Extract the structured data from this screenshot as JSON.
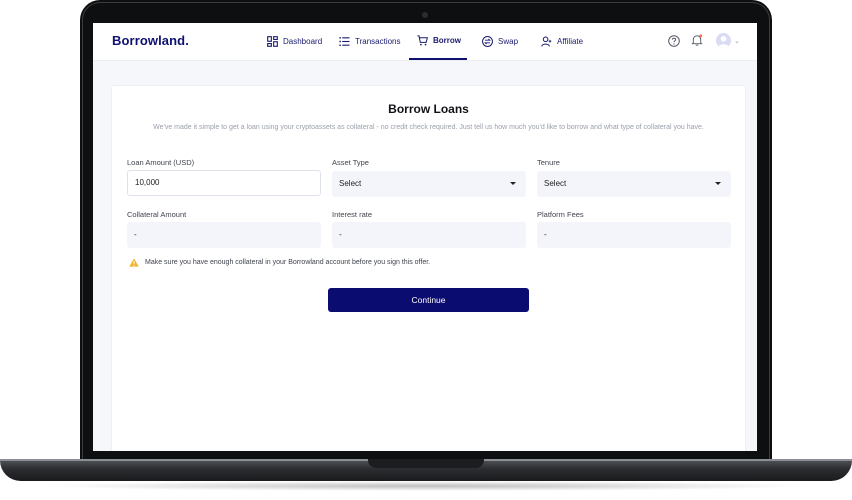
{
  "brand": {
    "logo": "Borrowland."
  },
  "nav": {
    "items": [
      {
        "label": "Dashboard",
        "icon": "dashboard-grid-icon"
      },
      {
        "label": "Transactions",
        "icon": "list-icon"
      },
      {
        "label": "Borrow",
        "icon": "cart-icon",
        "active": true
      },
      {
        "label": "Swap",
        "icon": "swap-icon"
      },
      {
        "label": "Affiliate",
        "icon": "user-plus-icon"
      }
    ],
    "right_icons": [
      "help-icon",
      "bell-icon",
      "avatar",
      "chevron-down-icon"
    ]
  },
  "page": {
    "title": "Borrow Loans",
    "subtitle": "We've made it simple to get a loan using your cryptoassets as collateral - no credit check required. Just tell us how much you'd like to borrow and what type of collateral you have."
  },
  "form": {
    "loan_amount": {
      "label": "Loan Amount (USD)",
      "value": "10,000"
    },
    "asset_type": {
      "label": "Asset Type",
      "value": "Select"
    },
    "tenure": {
      "label": "Tenure",
      "value": "Select"
    },
    "collateral_amount": {
      "label": "Collateral Amount",
      "value": "-"
    },
    "interest_rate": {
      "label": "Interest rate",
      "value": "-"
    },
    "platform_fees": {
      "label": "Platform Fees",
      "value": "-"
    }
  },
  "notice": {
    "text": "Make sure you have enough collateral in your Borrowland account before you sign this offer.",
    "icon": "warning-icon"
  },
  "actions": {
    "continue_label": "Continue"
  },
  "colors": {
    "brand": "#0b0c6f",
    "warning": "#f2b32a",
    "notification_dot": "#ff6b4a"
  }
}
